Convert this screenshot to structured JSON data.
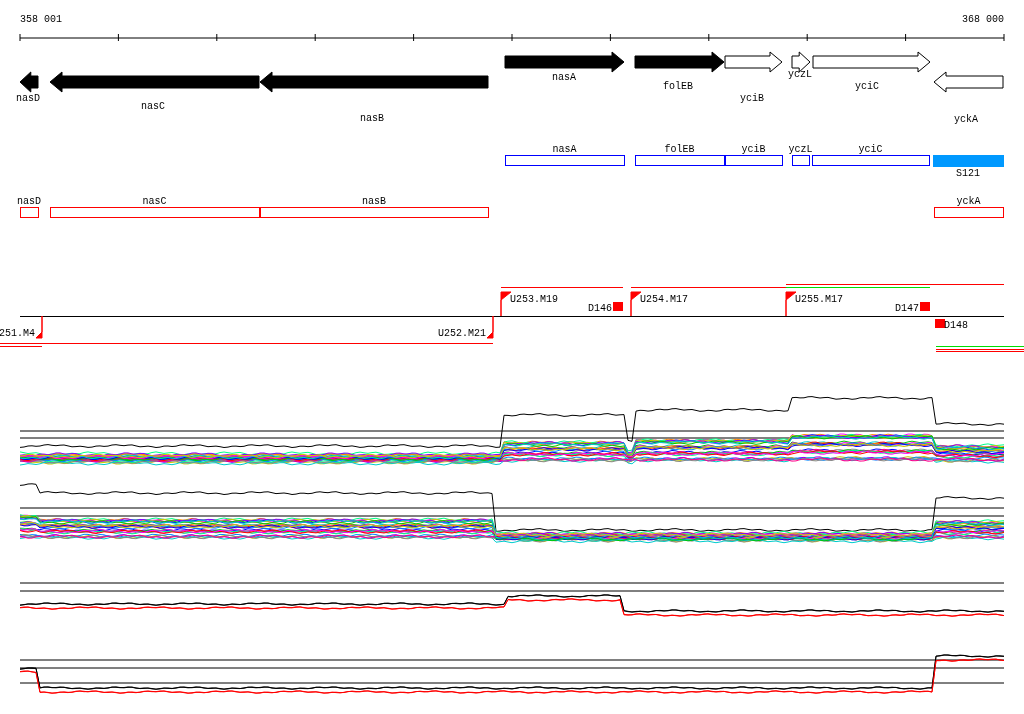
{
  "ruler": {
    "start_label": "358 001",
    "end_label": "368 000"
  },
  "genes": [
    {
      "name": "nasD",
      "reverse": true,
      "filled": true
    },
    {
      "name": "nasC",
      "reverse": true,
      "filled": true
    },
    {
      "name": "nasB",
      "reverse": true,
      "filled": true
    },
    {
      "name": "nasA",
      "reverse": false,
      "filled": true
    },
    {
      "name": "folEB",
      "reverse": false,
      "filled": true
    },
    {
      "name": "yciB",
      "reverse": false,
      "filled": false
    },
    {
      "name": "yczL",
      "reverse": false,
      "filled": false
    },
    {
      "name": "yciC",
      "reverse": false,
      "filled": false
    },
    {
      "name": "yckA",
      "reverse": true,
      "filled": false
    }
  ],
  "blue_track": [
    {
      "label": "nasA",
      "kind": "outline"
    },
    {
      "label": "folEB",
      "kind": "outline"
    },
    {
      "label": "yciB",
      "kind": "outline"
    },
    {
      "label": "yczL",
      "kind": "outline"
    },
    {
      "label": "yciC",
      "kind": "outline"
    },
    {
      "label": "S121",
      "kind": "solid"
    }
  ],
  "red_track": [
    {
      "label": "nasD"
    },
    {
      "label": "nasC"
    },
    {
      "label": "nasB"
    },
    {
      "label": "yckA"
    }
  ],
  "transcription_units": [
    {
      "label": "251.M4",
      "kind": "promoter"
    },
    {
      "label": "U252.M21",
      "kind": "promoter"
    },
    {
      "label": "U253.M19",
      "kind": "promoter"
    },
    {
      "label": "D146",
      "kind": "terminator"
    },
    {
      "label": "U254.M17",
      "kind": "promoter"
    },
    {
      "label": "U255.M17",
      "kind": "promoter"
    },
    {
      "label": "D147",
      "kind": "terminator"
    },
    {
      "label": "D148",
      "kind": "terminator"
    }
  ]
}
